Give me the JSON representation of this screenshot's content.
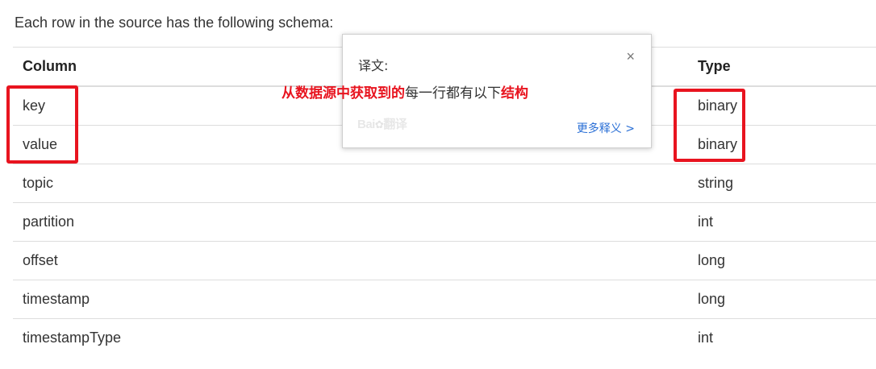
{
  "intro_text": "Each row in the source has the following schema:",
  "table": {
    "headers": {
      "column": "Column",
      "type": "Type"
    },
    "rows": [
      {
        "column": "key",
        "type": "binary"
      },
      {
        "column": "value",
        "type": "binary"
      },
      {
        "column": "topic",
        "type": "string"
      },
      {
        "column": "partition",
        "type": "int"
      },
      {
        "column": "offset",
        "type": "long"
      },
      {
        "column": "timestamp",
        "type": "long"
      },
      {
        "column": "timestampType",
        "type": "int"
      }
    ]
  },
  "popup": {
    "title": "译文:",
    "close_icon": "×",
    "translation_red_1": "从数据源中获取到的",
    "translation_plain": "每一行都有以下",
    "translation_red_2": "结构",
    "logo_text": "Bai",
    "logo_suffix": "翻译",
    "more_link": "更多释义 >"
  },
  "colors": {
    "highlight": "#e8141f",
    "link": "#2a6fd6",
    "border": "#dddddd"
  }
}
